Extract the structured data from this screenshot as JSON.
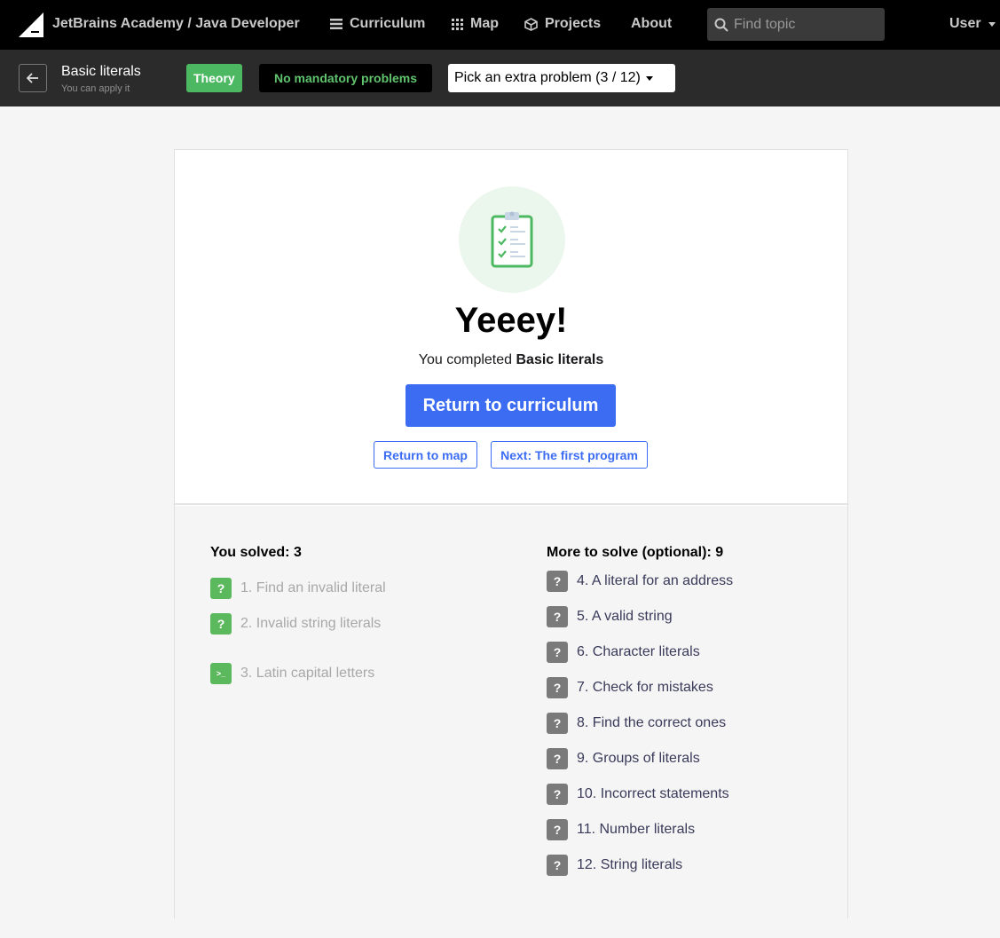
{
  "nav": {
    "brand": "JetBrains Academy / Java Developer",
    "curriculum": "Curriculum",
    "map": "Map",
    "projects": "Projects",
    "about": "About",
    "search_placeholder": "Find topic",
    "user": "User"
  },
  "subnav": {
    "title": "Basic literals",
    "subtitle": "You can apply it",
    "theory": "Theory",
    "no_mandatory": "No mandatory problems",
    "pick_extra": "Pick an extra problem (3 / 12)"
  },
  "completion": {
    "headline": "Yeeey!",
    "completed_prefix": "You completed",
    "completed_topic": "Basic literals",
    "return_curriculum": "Return to curriculum",
    "return_map": "Return to map",
    "next": "Next: The first program"
  },
  "solved": {
    "heading": "You solved: 3",
    "items": [
      {
        "label": "1. Find an invalid literal",
        "icon": "question-icon"
      },
      {
        "label": "2. Invalid string literals",
        "icon": "question-icon"
      },
      {
        "label": "3. Latin capital letters",
        "icon": "terminal-icon"
      }
    ]
  },
  "more": {
    "heading": "More to solve (optional): 9",
    "items": [
      {
        "label": "4. A literal for an address"
      },
      {
        "label": "5. A valid string"
      },
      {
        "label": "6. Character literals"
      },
      {
        "label": "7. Check for mistakes"
      },
      {
        "label": "8. Find the correct ones"
      },
      {
        "label": "9. Groups of literals"
      },
      {
        "label": "10. Incorrect statements"
      },
      {
        "label": "11. Number literals"
      },
      {
        "label": "12. String literals"
      }
    ]
  },
  "colors": {
    "accent": "#3b6cf2",
    "success": "#5cb85c",
    "nav_bg": "#000000",
    "subnav_bg": "#2b2b2b"
  }
}
